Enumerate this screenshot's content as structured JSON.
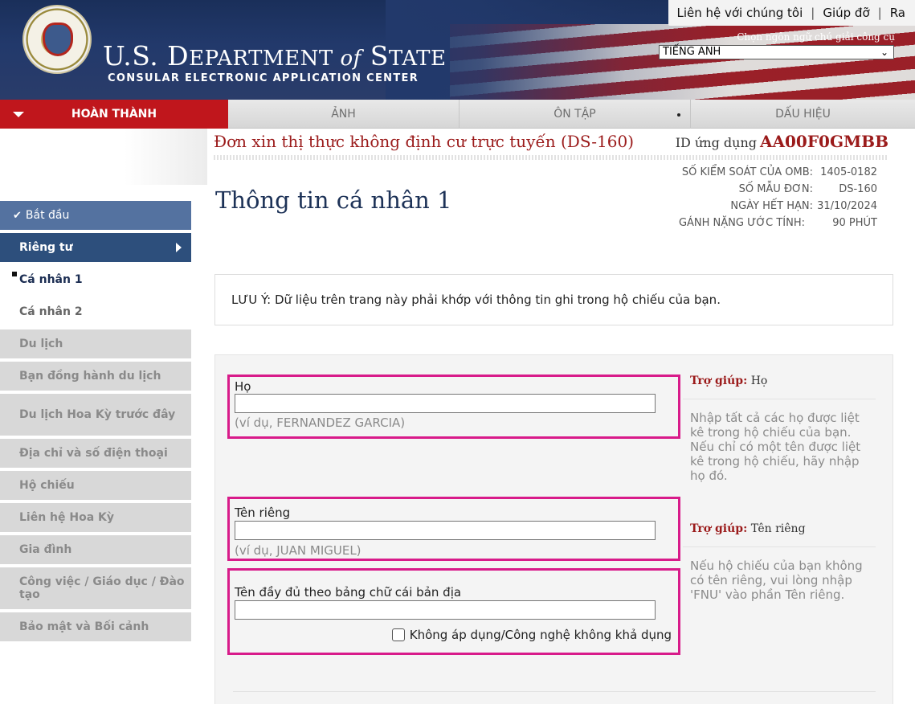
{
  "top_links": [
    "Liên hệ với chúng tôi",
    "Giúp đỡ",
    "Ra"
  ],
  "header": {
    "dept_title_a": "U.S. D",
    "dept_title_b": "EPARTMENT ",
    "dept_title_of": "of",
    "dept_title_c": " S",
    "dept_title_d": "TATE",
    "subtitle": "CONSULAR ELECTRONIC APPLICATION CENTER",
    "lang_label": "Chọn ngôn ngữ chú giải công cụ",
    "lang_value": "TIẾNG ANH",
    "lang_chevron": "⌄"
  },
  "tabs": [
    {
      "label": "HOÀN THÀNH",
      "active": true
    },
    {
      "label": "ẢNH"
    },
    {
      "label": "ÔN TẬP"
    },
    {
      "label": "DẤU HIỆU"
    }
  ],
  "nav": {
    "start": "Bắt đầu",
    "start_check": "✔",
    "personal": "Riêng tư",
    "personal1": "Cá nhân 1",
    "personal2": "Cá nhân 2",
    "grey_items": [
      "Du lịch",
      "Bạn đồng hành du lịch",
      "Du lịch Hoa Kỳ trước đây",
      "Địa chỉ và số điện thoại",
      "Hộ chiếu",
      "Liên hệ Hoa Kỳ",
      "Gia đình",
      "Công việc / Giáo dục / Đào tạo",
      "Bảo mật và Bối cảnh"
    ]
  },
  "app": {
    "title": "Đơn xin thị thực không định cư trực tuyến (DS-160)",
    "id_label": "ID ứng dụng",
    "id_value": "AA00F0GMBB"
  },
  "omb": {
    "control_label": "SỐ KIỂM SOÁT CỦA OMB:",
    "control_value": "1405-0182",
    "form_label": "SỐ MẪU ĐƠN:",
    "form_value": "DS-160",
    "expiry_label": "NGÀY HẾT HẠN:",
    "expiry_value": "31/10/2024",
    "burden_label": "GÁNH NẶNG ƯỚC TÍNH:",
    "burden_value": "90 PHÚT"
  },
  "page_title": "Thông tin cá nhân 1",
  "note": "LƯU Ý: Dữ liệu trên trang này phải khớp với thông tin ghi trong hộ chiếu của bạn.",
  "fields": {
    "surname_label": "Họ",
    "surname_value": "",
    "surname_hint": "(ví dụ, FERNANDEZ GARCIA)",
    "given_label": "Tên riêng",
    "given_value": "",
    "given_hint": "(ví dụ, JUAN MIGUEL)",
    "native_label": "Tên đầy đủ theo bảng chữ cái bản địa",
    "native_value": "",
    "na_label": "Không áp dụng/Công nghệ không khả dụng"
  },
  "help": {
    "prefix": "Trợ giúp:",
    "h1_topic": "Họ",
    "h1_body": "Nhập tất cả các họ được liệt kê trong hộ chiếu của bạn. Nếu chỉ có một tên được liệt kê trong hộ chiếu, hãy nhập họ đó.",
    "h2_topic": "Tên riêng",
    "h2_body": "Nếu hộ chiếu của bạn không có tên riêng, vui lòng nhập 'FNU' vào phần Tên riêng."
  },
  "colors": {
    "active_tab": "#c0161c",
    "nav_done": "#5472a0",
    "nav_section": "#2d4f7c",
    "highlight": "#d81b8a",
    "title_red": "#9b1b1b"
  }
}
